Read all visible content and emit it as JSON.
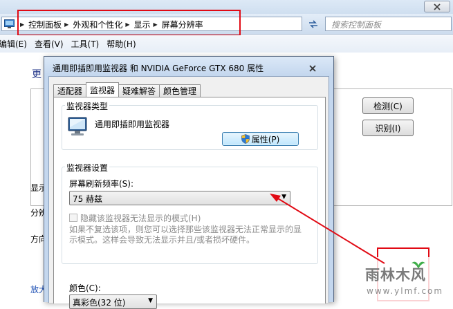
{
  "explorer": {
    "breadcrumbs": [
      "控制面板",
      "外观和个性化",
      "显示",
      "屏幕分辨率"
    ],
    "search_placeholder": "搜索控制面板",
    "menu": [
      "编辑(E)",
      "查看(V)",
      "工具(T)",
      "帮助(H)"
    ],
    "heading": "更",
    "detect_button": "检测(C)",
    "identify_button": "识别(I)",
    "display_label": "显示",
    "resolution_label": "分辨",
    "orientation_label": "方向",
    "link": "放大"
  },
  "dialog": {
    "title": "通用即插即用监视器 和 NVIDIA GeForce GTX 680 属性",
    "tabs": [
      {
        "label": "适配器",
        "active": false
      },
      {
        "label": "监视器",
        "active": true
      },
      {
        "label": "疑难解答",
        "active": false
      },
      {
        "label": "颜色管理",
        "active": false
      }
    ],
    "monitor_type_group": "监视器类型",
    "monitor_name": "通用即插即用监视器",
    "properties_button": "属性(P)",
    "monitor_settings_group": "监视器设置",
    "refresh_rate_label": "屏幕刷新频率(S):",
    "refresh_rate_value": "75 赫兹",
    "hide_modes_label": "隐藏该监视器无法显示的模式(H)",
    "hide_modes_checked": false,
    "hint": "如果不复选该项，则您可以选择那些该监视器无法正常显示的显示模式。这样会导致无法显示并且/或者损坏硬件。",
    "color_label": "颜色(C):",
    "color_value": "真彩色(32 位)"
  },
  "watermark": {
    "main": "雨林木风",
    "sub": "www.ylmf.com"
  },
  "colors": {
    "annotation_red": "#e10a14",
    "title_blue": "#c4d7ee",
    "heading_blue": "#1e3287"
  }
}
